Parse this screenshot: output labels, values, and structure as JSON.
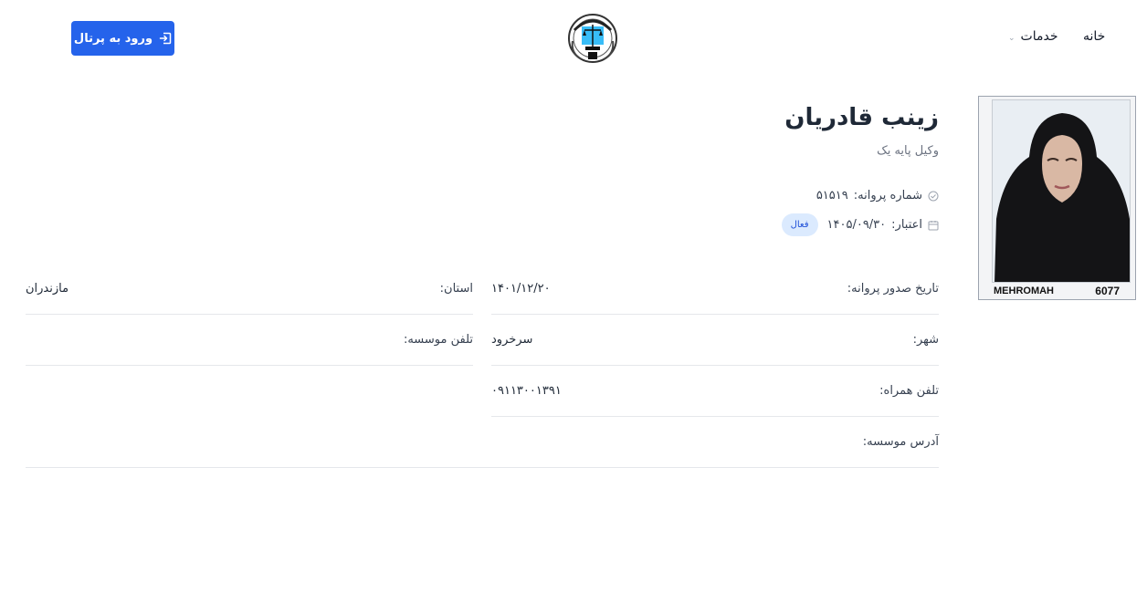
{
  "nav": {
    "home": "خانه",
    "services": "خدمات"
  },
  "portal_button": {
    "label": "ورود به پرتال"
  },
  "photo": {
    "caption_left": "MEHROMAH",
    "caption_right": "6077"
  },
  "profile": {
    "name": "زینب قادریان",
    "title": "وکیل پایه یک",
    "license_label": "شماره پروانه:",
    "license_number": "۵۱۵۱۹",
    "validity_label": "اعتبار:",
    "validity_date": "۱۴۰۵/۰۹/۳۰",
    "status": "فعال"
  },
  "fields": {
    "issue_date_label": "تاریخ صدور پروانه:",
    "issue_date_value": "۱۴۰۱/۱۲/۲۰",
    "province_label": "استان:",
    "province_value": "مازندران",
    "city_label": "شهر:",
    "city_value": "سرخرود",
    "institute_phone_label": "تلفن موسسه:",
    "institute_phone_value": "",
    "mobile_label": "تلفن همراه:",
    "mobile_value": "۰۹۱۱۳۰۰۱۳۹۱",
    "address_label": "آدرس موسسه:",
    "address_value": ""
  },
  "colors": {
    "primary": "#2563eb",
    "badge_bg": "#dbeafe",
    "badge_text": "#1d4ed8"
  }
}
